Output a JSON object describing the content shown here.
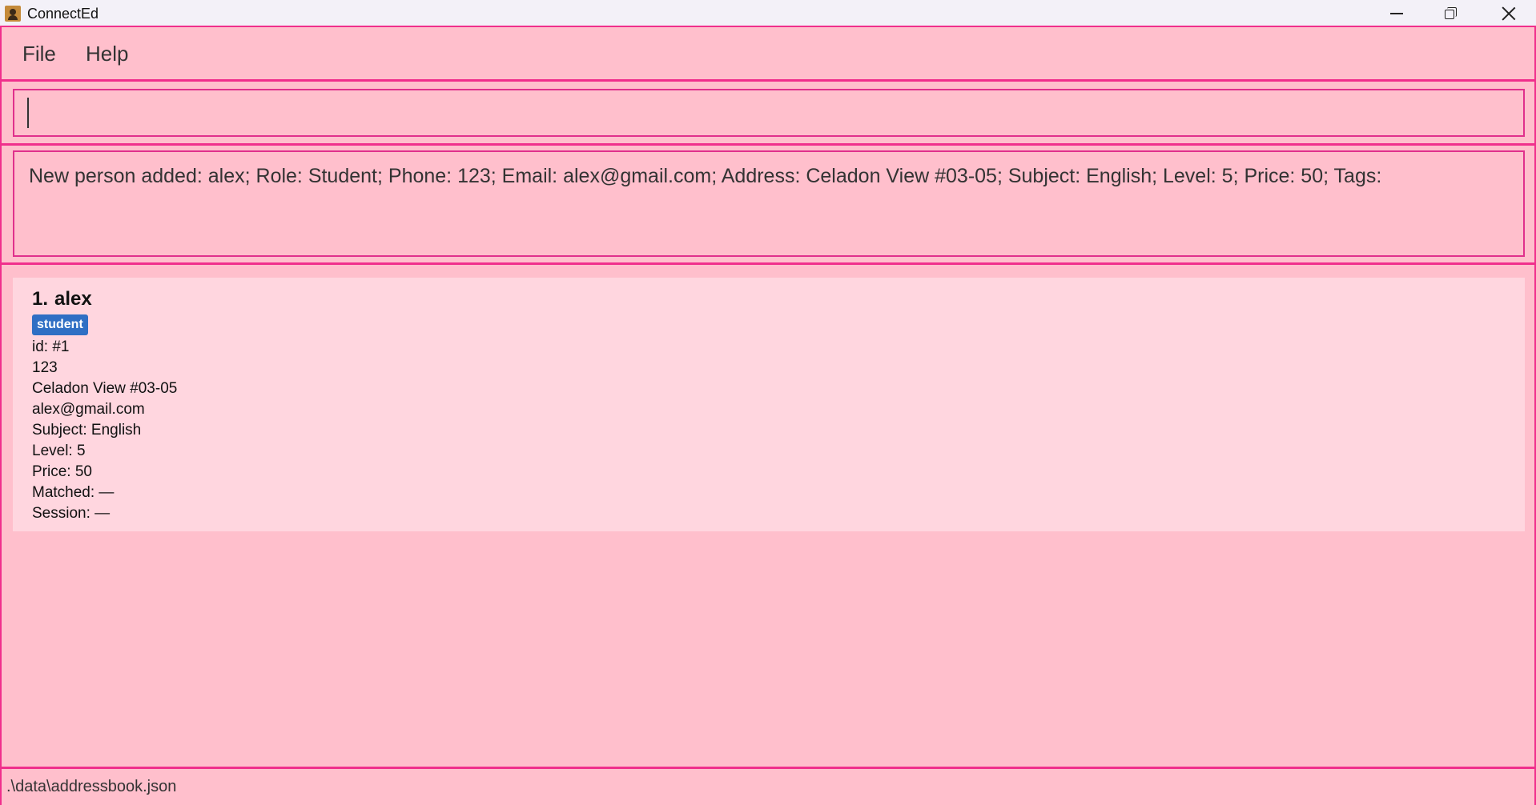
{
  "window": {
    "title": "ConnectEd"
  },
  "menu": {
    "file": "File",
    "help": "Help"
  },
  "command": {
    "value": ""
  },
  "result": {
    "text": "New person added: alex; Role: Student; Phone: 123; Email: alex@gmail.com; Address: Celadon View #03-05; Subject: English; Level: 5; Price: 50; Tags:"
  },
  "persons": [
    {
      "index": "1.",
      "name": "alex",
      "role_tag": "student",
      "id": "id: #1",
      "phone": "123",
      "address": "Celadon View #03-05",
      "email": "alex@gmail.com",
      "subject": "Subject: English",
      "level": "Level: 5",
      "price": "Price: 50",
      "matched": "Matched: —",
      "session": "Session: —"
    }
  ],
  "status": {
    "path": ".\\data\\addressbook.json"
  },
  "colors": {
    "background": "#FFBFCC",
    "border": "#F02F8C",
    "card": "#FFD6DF",
    "tag": "#2F6FC4"
  }
}
